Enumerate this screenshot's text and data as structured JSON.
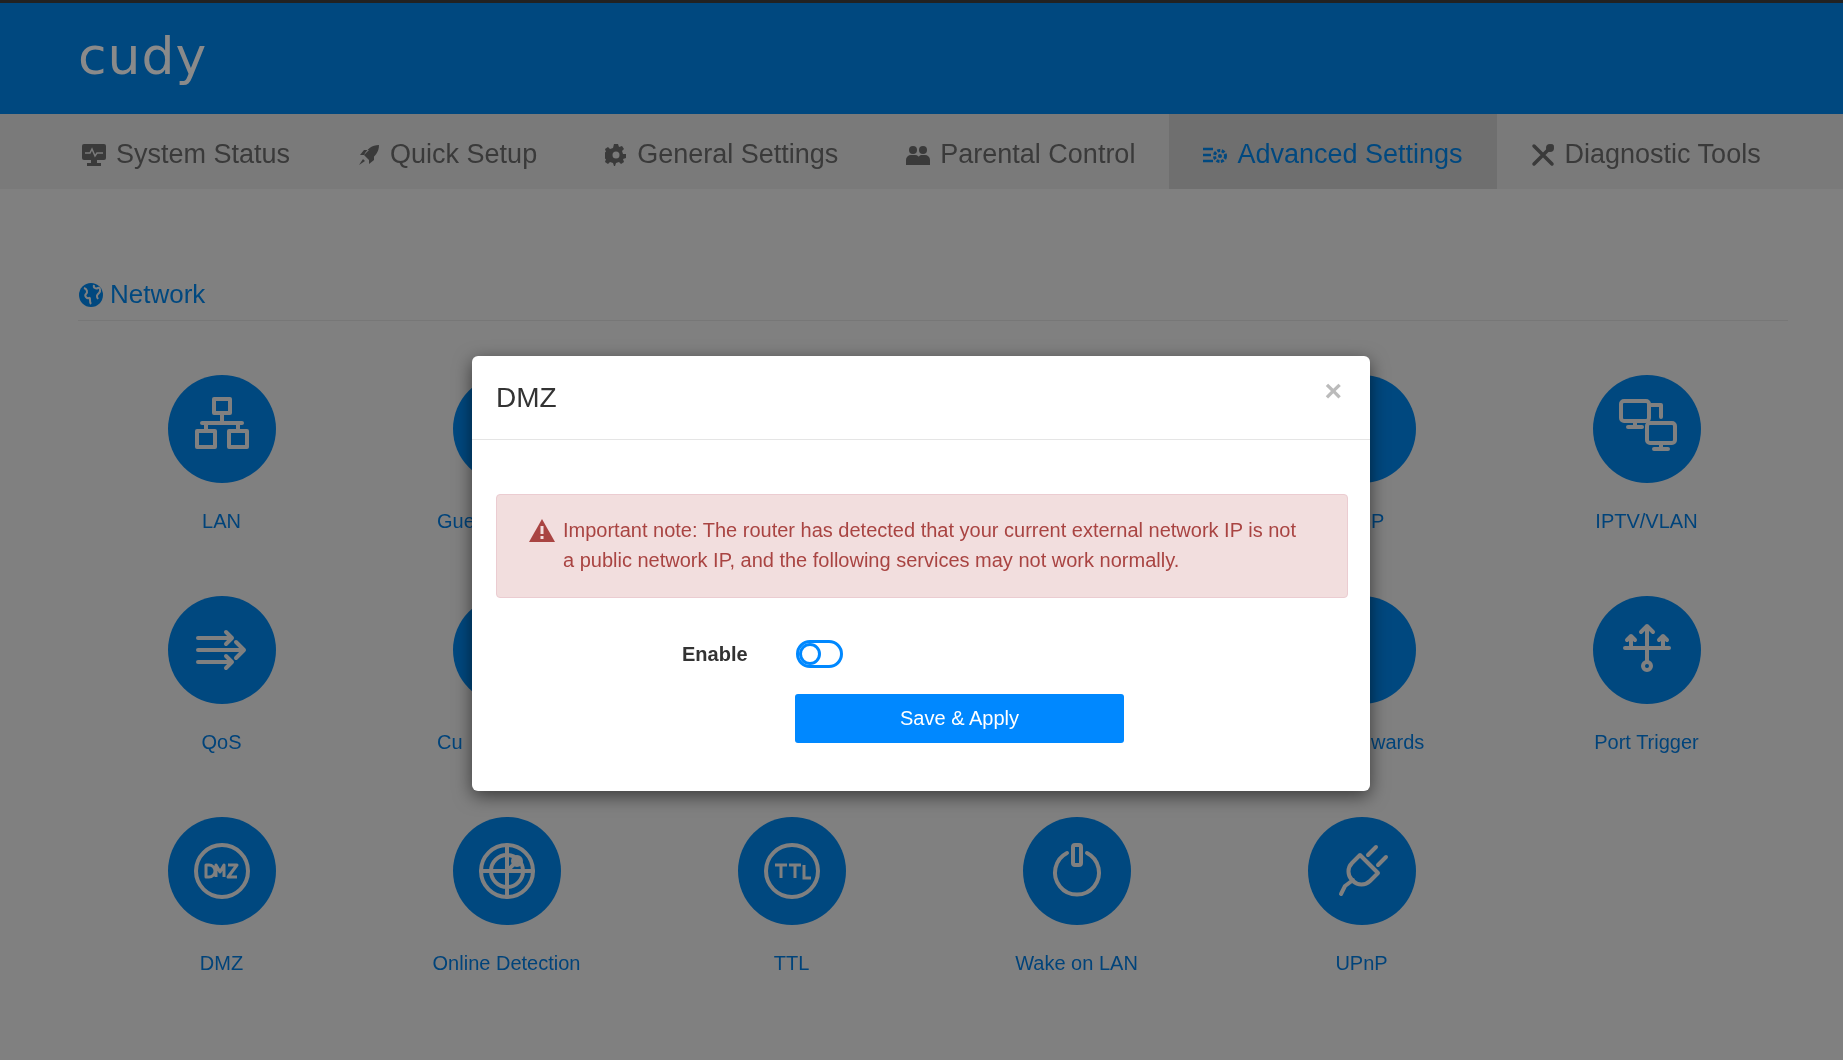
{
  "header": {
    "logo": "cudy"
  },
  "nav": [
    {
      "label": "System Status",
      "selected": false
    },
    {
      "label": "Quick Setup",
      "selected": false
    },
    {
      "label": "General Settings",
      "selected": false
    },
    {
      "label": "Parental Control",
      "selected": false
    },
    {
      "label": "Advanced Settings",
      "selected": true
    },
    {
      "label": "Diagnostic Tools",
      "selected": false
    }
  ],
  "section": {
    "title": "Network"
  },
  "features": [
    {
      "label": "LAN"
    },
    {
      "label": "Gue"
    },
    {
      "label": "P"
    },
    {
      "label": "IPTV/VLAN"
    },
    {
      "label": "QoS"
    },
    {
      "label": "Cu"
    },
    {
      "label": "wards"
    },
    {
      "label": "Port Trigger"
    },
    {
      "label": "DMZ"
    },
    {
      "label": "Online Detection"
    },
    {
      "label": "TTL"
    },
    {
      "label": "Wake on LAN"
    },
    {
      "label": "UPnP"
    }
  ],
  "dialog": {
    "title": "DMZ",
    "close": "×",
    "alert": "Important note: The router has detected that your current external network IP is not a public network IP, and the following services may not work normally.",
    "enable_label": "Enable",
    "enabled": false,
    "button": "Save & Apply"
  }
}
